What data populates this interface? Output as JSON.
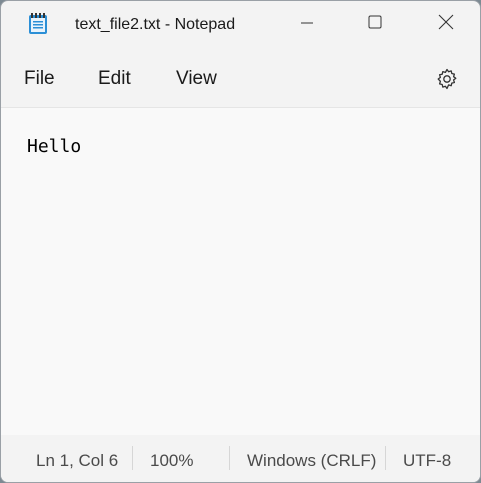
{
  "window": {
    "title": "text_file2.txt - Notepad",
    "app_icon": "notepad-icon",
    "controls": [
      "minimize-icon",
      "maximize-icon",
      "close-icon"
    ]
  },
  "menu": {
    "file": "File",
    "edit": "Edit",
    "view": "View",
    "settings_icon": "gear-icon"
  },
  "editor": {
    "content": "Hello"
  },
  "status": {
    "position": "Ln 1, Col 6",
    "zoom": "100%",
    "line_ending": "Windows (CRLF)",
    "encoding": "UTF-8"
  },
  "colors": {
    "window_bg": "#f3f3f3",
    "editor_bg": "#f9f9f9",
    "icon_blue": "#2b8fd6"
  }
}
